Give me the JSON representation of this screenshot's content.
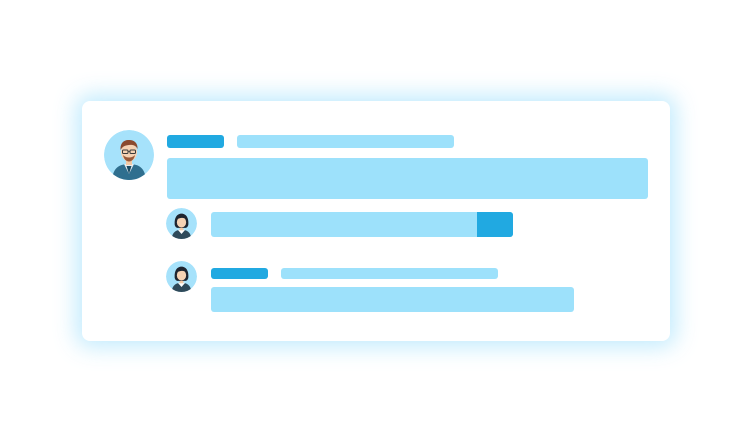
{
  "colors": {
    "accent": "#21a9e1",
    "placeholder": "#9de1fb",
    "avatar_bg": "#a6e2fb",
    "card_glow": "#78d2fa"
  },
  "comment": {
    "avatar_icon": "man-with-glasses-avatar-icon",
    "author": "",
    "meta": "",
    "body": ""
  },
  "reply_composer": {
    "avatar_icon": "woman-avatar-icon",
    "input_value": "",
    "send_icon": "send-button-icon"
  },
  "reply": {
    "avatar_icon": "woman-avatar-icon",
    "author": "",
    "meta": "",
    "body": ""
  }
}
